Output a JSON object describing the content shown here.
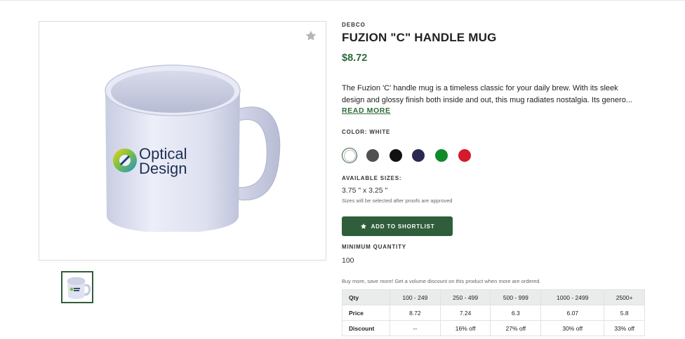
{
  "product": {
    "brand": "DEBCO",
    "title": "FUZION \"C\" HANDLE MUG",
    "price": "$8.72",
    "description_line1": "The Fuzion 'C' handle mug is a timeless classic for your daily brew. With its sleek",
    "description_line2": "design and glossy finish both inside and out, this mug radiates nostalgia. Its genero...",
    "read_more": "READ MORE",
    "mug_logo_line1": "Optical",
    "mug_logo_line2": "Design"
  },
  "colors": {
    "label": "COLOR: WHITE",
    "swatches": [
      {
        "name": "white",
        "hex": "#ffffff",
        "selected": true
      },
      {
        "name": "gray",
        "hex": "#505050"
      },
      {
        "name": "black",
        "hex": "#111111"
      },
      {
        "name": "navy",
        "hex": "#2c2950"
      },
      {
        "name": "green",
        "hex": "#0f8a2a"
      },
      {
        "name": "red",
        "hex": "#d41a2c"
      }
    ]
  },
  "sizes": {
    "label": "AVAILABLE SIZES:",
    "value": "3.75 \" x 3.25 \"",
    "note": "Sizes will be selected after proofs are approved"
  },
  "shortlist_button": {
    "label": "ADD TO SHORTLIST",
    "icon": "star-icon"
  },
  "minimum_quantity": {
    "label": "MINIMUM QUANTITY",
    "value": "100"
  },
  "pricing": {
    "note": "Buy more, save more! Get a volume discount on this product when more are ordered.",
    "headers": [
      "Qty",
      "100 - 249",
      "250 - 499",
      "500 - 999",
      "1000 - 2499",
      "2500+"
    ],
    "price_row": [
      "Price",
      "8.72",
      "7.24",
      "6.3",
      "6.07",
      "5.8"
    ],
    "discount_row": [
      "Discount",
      "--",
      "16% off",
      "27% off",
      "30% off",
      "33% off"
    ]
  },
  "theme": {
    "accent": "#2e5e3a",
    "price_color": "#2e6b3a"
  }
}
